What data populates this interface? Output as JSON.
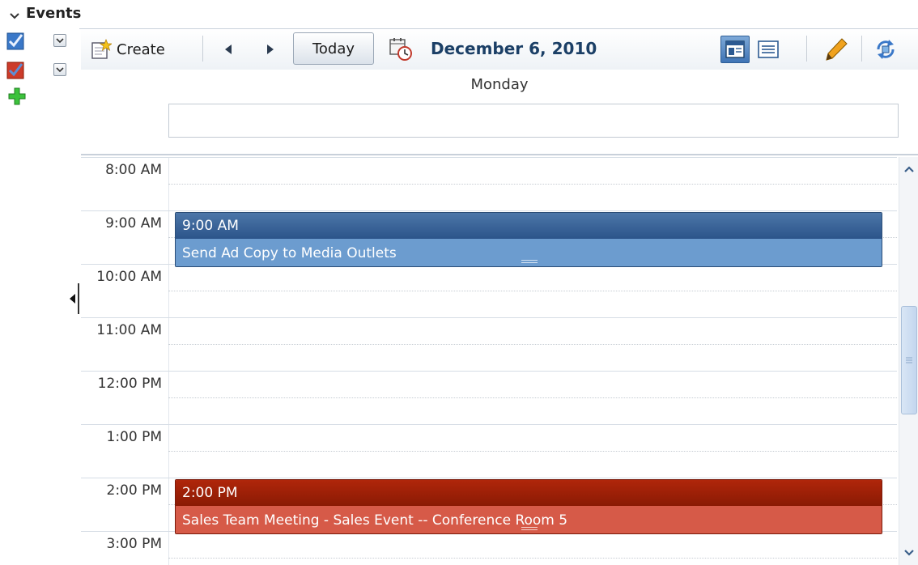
{
  "panel": {
    "title": "Events"
  },
  "calendars": [
    {
      "color": "#3a78c8",
      "checked": true
    },
    {
      "color": "#cc3b2a",
      "checked": true
    }
  ],
  "toolbar": {
    "create_label": "Create",
    "today_label": "Today",
    "date_label": "December 6, 2010"
  },
  "day": {
    "name": "Monday"
  },
  "hours": [
    "8:00 AM",
    "9:00 AM",
    "10:00 AM",
    "11:00 AM",
    "12:00 PM",
    "1:00 PM",
    "2:00 PM",
    "3:00 PM"
  ],
  "events": [
    {
      "time": "9:00 AM",
      "title": "Send Ad Copy to Media Outlets",
      "color": "#2c548a"
    },
    {
      "time": "2:00 PM",
      "title": "Sales Team Meeting - Sales Event -- Conference Room 5",
      "color": "#8a1a04"
    }
  ],
  "icons": {
    "collapse": "chevron-down-icon",
    "create": "create-event-icon",
    "prev": "previous-arrow-icon",
    "next": "next-arrow-icon",
    "datepicker": "calendar-picker-icon",
    "dayview": "day-view-icon",
    "listview": "list-view-icon",
    "edit": "pencil-icon",
    "refresh": "refresh-icon",
    "add": "add-calendar-icon"
  }
}
